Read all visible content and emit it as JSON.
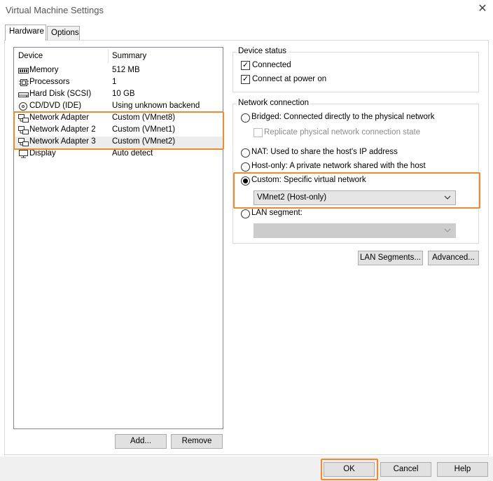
{
  "window": {
    "title": "Virtual Machine Settings",
    "close_glyph": "✕"
  },
  "tabs": [
    {
      "label": "Hardware"
    },
    {
      "label": "Options"
    }
  ],
  "device_list": {
    "col_device": "Device",
    "col_summary": "Summary",
    "rows": [
      {
        "device": "Memory",
        "summary": "512 MB",
        "icon": "memory-icon"
      },
      {
        "device": "Processors",
        "summary": "1",
        "icon": "processor-icon"
      },
      {
        "device": "Hard Disk (SCSI)",
        "summary": "10 GB",
        "icon": "hard-disk-icon"
      },
      {
        "device": "CD/DVD (IDE)",
        "summary": "Using unknown backend",
        "icon": "cd-dvd-icon"
      },
      {
        "device": "Network Adapter",
        "summary": "Custom (VMnet8)",
        "icon": "network-adapter-icon"
      },
      {
        "device": "Network Adapter 2",
        "summary": "Custom (VMnet1)",
        "icon": "network-adapter-icon"
      },
      {
        "device": "Network Adapter 3",
        "summary": "Custom (VMnet2)",
        "icon": "network-adapter-icon"
      },
      {
        "device": "Display",
        "summary": "Auto detect",
        "icon": "display-icon"
      }
    ],
    "add_label": "Add...",
    "remove_label": "Remove"
  },
  "device_status": {
    "title": "Device status",
    "connected_label": "Connected",
    "connected_checked": true,
    "power_on_label": "Connect at power on",
    "power_on_checked": true
  },
  "network_connection": {
    "title": "Network connection",
    "bridged_label": "Bridged: Connected directly to the physical network",
    "replicate_label": "Replicate physical network connection state",
    "nat_label": "NAT: Used to share the host's IP address",
    "hostonly_label": "Host-only: A private network shared with the host",
    "custom_label": "Custom: Specific virtual network",
    "custom_value": "VMnet2 (Host-only)",
    "lan_label": "LAN segment:",
    "lan_value": "",
    "selected": "custom",
    "lan_segments_label": "LAN Segments...",
    "advanced_label": "Advanced..."
  },
  "footer": {
    "ok_label": "OK",
    "cancel_label": "Cancel",
    "help_label": "Help"
  },
  "colors": {
    "highlight": "#f08a2c",
    "selected_row": "#ececec"
  }
}
